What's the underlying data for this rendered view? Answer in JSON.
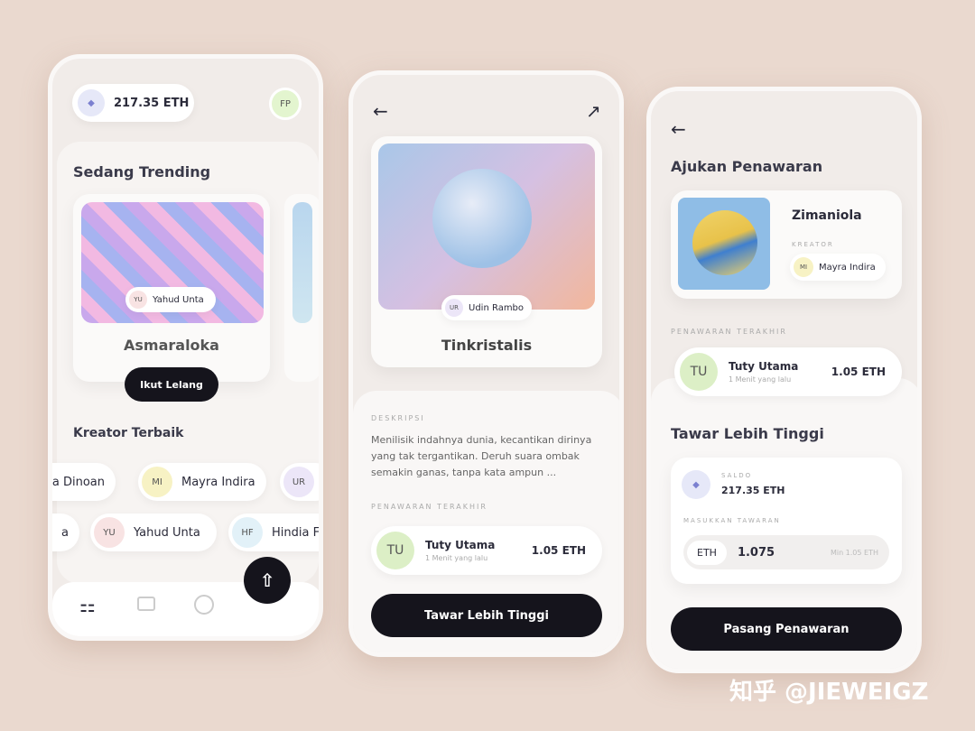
{
  "home": {
    "balance": "217.35 ETH",
    "user_initials": "FP",
    "trending_title": "Sedang Trending",
    "trending_item": {
      "title": "Asmaraloka",
      "creator_initials": "YU",
      "creator": "Yahud Unta",
      "button": "Ikut Lelang"
    },
    "creators_title": "Kreator Terbaik",
    "creators_row1": [
      {
        "initials": "",
        "name": "na Dinoan",
        "color": "#ffffff"
      },
      {
        "initials": "MI",
        "name": "Mayra Indira",
        "color": "#f7f2c4"
      },
      {
        "initials": "UR",
        "name": "",
        "color": "#ece6f8"
      }
    ],
    "creators_row2": [
      {
        "initials": "",
        "name": "a",
        "color": "#ffffff"
      },
      {
        "initials": "YU",
        "name": "Yahud Unta",
        "color": "#f8e3e3"
      },
      {
        "initials": "HF",
        "name": "Hindia Fia",
        "color": "#e2f1f8"
      }
    ]
  },
  "detail": {
    "title": "Tinkristalis",
    "creator_initials": "UR",
    "creator": "Udin Rambo",
    "desc_label": "DESKRIPSI",
    "description": "Menilisik indahnya dunia, kecantikan dirinya yang tak tergantikan. Deruh suara ombak semakin ganas, tanpa kata ampun ...",
    "bids_label": "PENAWARAN TERAKHIR",
    "bid": {
      "initials": "TU",
      "name": "Tuty Utama",
      "time": "1 Menit yang lalu",
      "amount": "1.05 ETH"
    },
    "button": "Tawar Lebih Tinggi"
  },
  "offer": {
    "title": "Ajukan Penawaran",
    "item_title": "Zimaniola",
    "creator_label": "KREATOR",
    "creator_initials": "MI",
    "creator": "Mayra Indira",
    "bids_label": "PENAWARAN TERAKHIR",
    "bid": {
      "initials": "TU",
      "name": "Tuty Utama",
      "time": "1 Menit yang lalu",
      "amount": "1.05 ETH"
    },
    "higher_title": "Tawar Lebih Tinggi",
    "saldo_label": "SALDO",
    "saldo": "217.35 ETH",
    "input_label": "MASUKKAN TAWARAN",
    "currency": "ETH",
    "input_value": "1.075",
    "min_hint": "Min 1.05 ETH",
    "button": "Pasang Penawaran"
  },
  "watermark": "知乎 @JIEWEIGZ"
}
